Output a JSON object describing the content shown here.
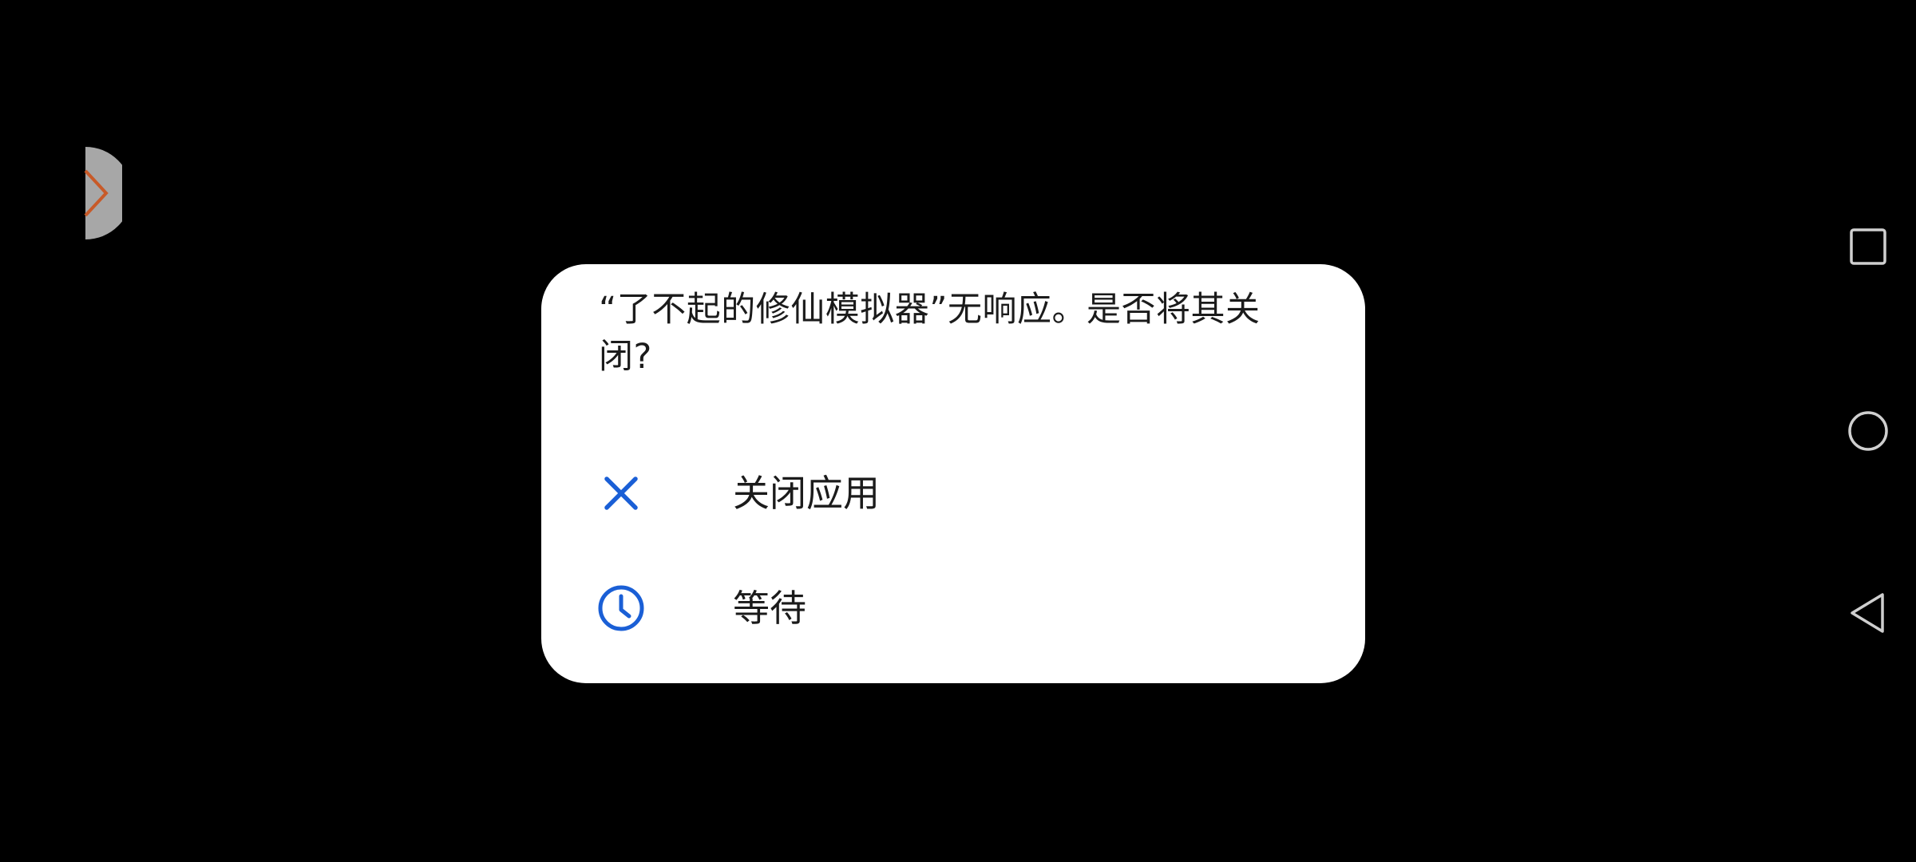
{
  "dialog": {
    "message": "“了不起的修仙模拟器”无响应。是否将其关闭?",
    "options": [
      {
        "label": "关闭应用",
        "icon": "close-icon"
      },
      {
        "label": "等待",
        "icon": "clock-icon"
      }
    ]
  },
  "edge_tab": {
    "icon": "chevron-right-icon"
  },
  "navigation": {
    "recents_icon": "square-icon",
    "home_icon": "circle-icon",
    "back_icon": "triangle-back-icon"
  },
  "colors": {
    "background": "#000000",
    "dialog_background": "#ffffff",
    "accent": "#1a5fd6",
    "text": "#1b1b1b",
    "edge_tab": "#a7a7a7",
    "edge_chevron": "#c85a28",
    "nav_icon": "#cfcfcf"
  }
}
